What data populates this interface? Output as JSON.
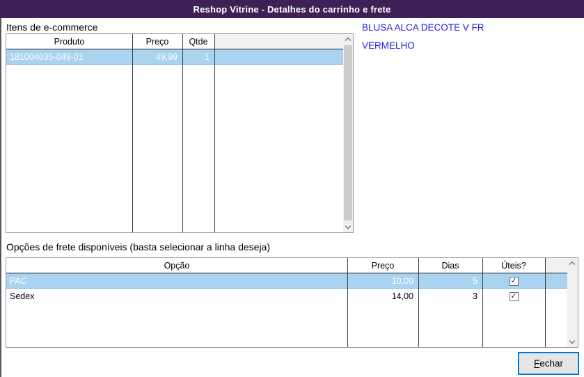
{
  "window": {
    "title": "Reshop Vitrine - Detalhes do carrinho e frete"
  },
  "items_section": {
    "label": "Itens de e-commerce",
    "columns": {
      "produto": "Produto",
      "preco": "Preço",
      "qtde": "Qtde"
    },
    "rows": [
      {
        "produto": "181004035-049-01",
        "preco": "49,99",
        "qtde": "1",
        "selected": true
      }
    ]
  },
  "product_details": {
    "name": "BLUSA ALCA DECOTE V FR",
    "color": "VERMELHO"
  },
  "shipping_section": {
    "label": "Opções de frete disponíveis (basta selecionar a linha deseja)",
    "columns": {
      "opcao": "Opção",
      "preco": "Preço",
      "dias": "Dias",
      "uteis": "Úteis?"
    },
    "rows": [
      {
        "opcao": "PAC",
        "preco": "10,00",
        "dias": "5",
        "uteis_checked": true,
        "selected": true
      },
      {
        "opcao": "Sedex",
        "preco": "14,00",
        "dias": "3",
        "uteis_checked": true,
        "selected": false
      }
    ]
  },
  "footer": {
    "close_mnemonic": "F",
    "close_rest": "echar"
  },
  "icons": {
    "checkmark": "✓"
  },
  "colors": {
    "titlebar": "#3E2056",
    "selection_fill": "#A9D3EE",
    "link_blue": "#2323E6",
    "focus_border": "#0078D7",
    "gridline": "#3b3b3b"
  }
}
